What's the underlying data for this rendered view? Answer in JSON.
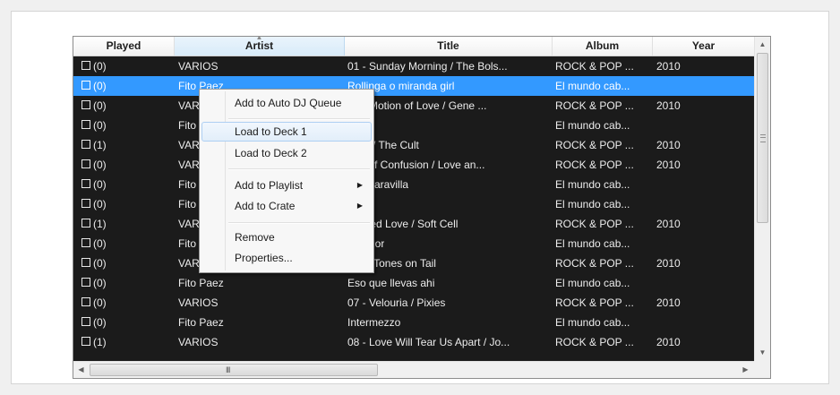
{
  "columns": [
    {
      "key": "played",
      "label": "Played"
    },
    {
      "key": "artist",
      "label": "Artist"
    },
    {
      "key": "title",
      "label": "Title"
    },
    {
      "key": "album",
      "label": "Album"
    },
    {
      "key": "year",
      "label": "Year"
    }
  ],
  "rows": [
    {
      "played": "(0)",
      "artist": "VARIOS",
      "title": "01 - Sunday Morning / The Bols...",
      "album": "ROCK & POP ...",
      "year": "2010"
    },
    {
      "played": "(0)",
      "artist": "Fito Paez",
      "title": "Rollinga o miranda girl",
      "album": "El mundo cab...",
      "year": ""
    },
    {
      "played": "(0)",
      "artist": "VAR",
      "title": "The Motion of Love / Gene ...",
      "album": "ROCK & POP ...",
      "year": "2010"
    },
    {
      "played": "(0)",
      "artist": "Fito",
      "title": "viara",
      "album": "El mundo cab...",
      "year": ""
    },
    {
      "played": "(1)",
      "artist": "VAR",
      "title": "Rain / The Cult",
      "album": "ROCK & POP ...",
      "year": "2010"
    },
    {
      "played": "(0)",
      "artist": "VAR",
      "title": "Ball of Confusion / Love an...",
      "album": "ROCK & POP ...",
      "year": "2010"
    },
    {
      "played": "(0)",
      "artist": "Fito",
      "title": "ent maravilla",
      "album": "El mundo cab...",
      "year": ""
    },
    {
      "played": "(0)",
      "artist": "Fito",
      "title": "nce",
      "album": "El mundo cab...",
      "year": ""
    },
    {
      "played": "(1)",
      "artist": "VAR",
      "title": "Tainted Love / Soft Cell",
      "album": "ROCK & POP ...",
      "year": "2010"
    },
    {
      "played": "(0)",
      "artist": "Fito",
      "title": "or amor",
      "album": "El mundo cab...",
      "year": ""
    },
    {
      "played": "(0)",
      "artist": "VAR",
      "title": "Go! / Tones on Tail",
      "album": "ROCK & POP ...",
      "year": "2010"
    },
    {
      "played": "(0)",
      "artist": "Fito Paez",
      "title": "Eso que llevas ahi",
      "album": "El mundo cab...",
      "year": ""
    },
    {
      "played": "(0)",
      "artist": "VARIOS",
      "title": "07 - Velouria / Pixies",
      "album": "ROCK & POP ...",
      "year": "2010"
    },
    {
      "played": "(0)",
      "artist": "Fito Paez",
      "title": "Intermezzo",
      "album": "El mundo cab...",
      "year": ""
    },
    {
      "played": "(1)",
      "artist": "VARIOS",
      "title": "08 - Love Will Tear Us Apart / Jo...",
      "album": "ROCK & POP ...",
      "year": "2010"
    }
  ],
  "selected_row": 1,
  "context_menu": {
    "add_auto_dj": "Add to Auto DJ Queue",
    "load_deck_1": "Load to Deck 1",
    "load_deck_2": "Load to Deck 2",
    "add_playlist": "Add to Playlist",
    "add_crate": "Add to Crate",
    "remove": "Remove",
    "properties": "Properties...",
    "highlighted": "Load to Deck 1"
  },
  "scrollbars": {
    "up_arrow": "▲",
    "down_arrow": "▼",
    "left_arrow": "◀",
    "right_arrow": "▶",
    "h_grip": "III"
  },
  "colors": {
    "table_background": "#1b1b1b",
    "selection": "#3399ff",
    "row_text": "#ececec"
  }
}
